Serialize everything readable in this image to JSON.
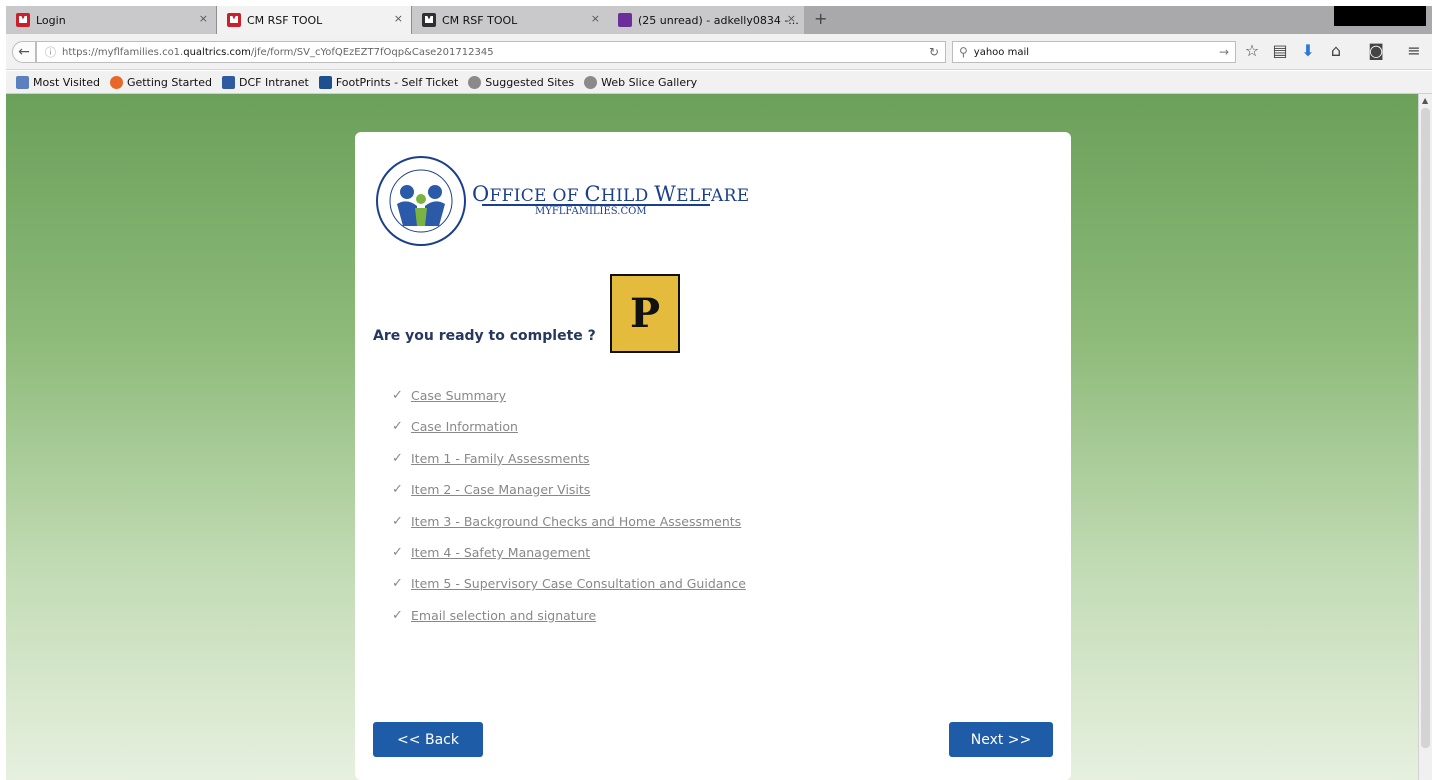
{
  "browser": {
    "tabs": [
      {
        "label": "Login",
        "icon": "red-m-icon",
        "active": false
      },
      {
        "label": "CM RSF TOOL",
        "icon": "red-m-icon",
        "active": true
      },
      {
        "label": "CM RSF TOOL",
        "icon": "dark-m-icon",
        "active": false
      },
      {
        "label": "(25 unread) - adkelly0834 -...",
        "icon": "mail-icon",
        "active": false
      }
    ],
    "new_tab_label": "+",
    "close_glyph": "×",
    "url_prefix": "https://myflfamilies.co1.",
    "url_domain": "qualtrics.com",
    "url_path": "/jfe/form/SV_cYofQEzEZT7fOqp&Case201712345",
    "search_value": "yahoo mail"
  },
  "bookmarks": [
    {
      "label": "Most Visited",
      "color": "#5b7fbf"
    },
    {
      "label": "Getting Started",
      "color": "#e8662a"
    },
    {
      "label": "DCF Intranet",
      "color": "#2f5aa0"
    },
    {
      "label": "FootPrints - Self Ticket",
      "color": "#1e4f8f"
    },
    {
      "label": "Suggested Sites",
      "color": "#8a8a8a"
    },
    {
      "label": "Web Slice Gallery",
      "color": "#8a8a8a"
    }
  ],
  "header": {
    "logo_ring_text": "FLORIDA DEPARTMENT OF CHILDREN AND FAMILIES",
    "title_first": "O",
    "title_rest": "FFICE OF ",
    "title_c": "C",
    "title_hild": "HILD ",
    "title_w": "W",
    "title_elfare": "ELFARE",
    "subtitle": "MYFLFAMILIES.COM",
    "badge_letter": "P"
  },
  "form": {
    "question": "Are you ready to complete ?",
    "checkmark": "✓",
    "items": [
      "Case Summary",
      "Case Information",
      "Item 1 - Family Assessments",
      "Item 2 - Case Manager Visits",
      "Item 3 - Background Checks and Home Assessments",
      "Item 4 - Safety Management",
      "Item 5 - Supervisory Case Consultation and Guidance",
      "Email selection and signature"
    ],
    "back_label": "<< Back",
    "next_label": "Next >>"
  },
  "colors": {
    "accent_blue": "#1e5ca8",
    "badge_yellow": "#e4bb3d",
    "logo_navy": "#1c3f8c",
    "background_green_top": "#6ba05a"
  }
}
